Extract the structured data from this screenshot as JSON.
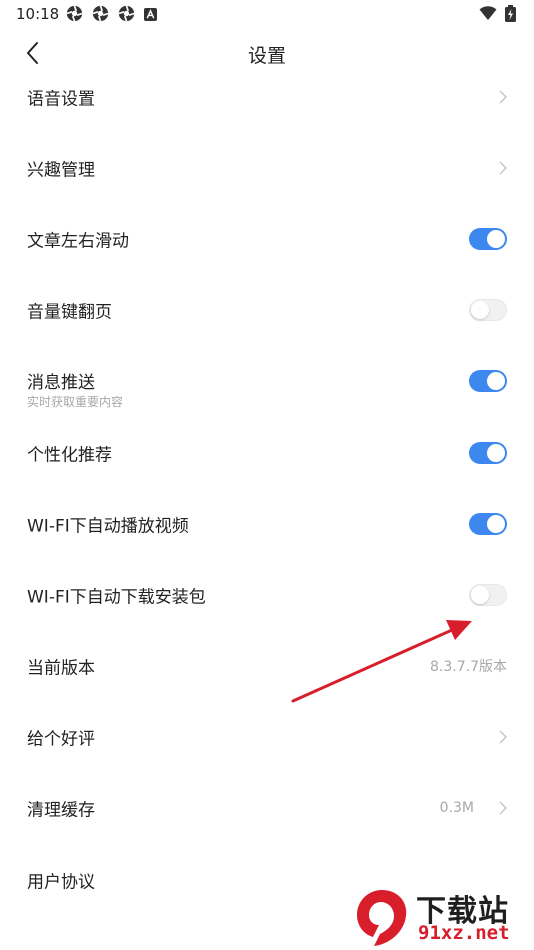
{
  "status_bar": {
    "time": "10:18",
    "left_icons": [
      "aperture-icon",
      "aperture-icon",
      "aperture-icon",
      "a-letter-icon"
    ],
    "right_icons": [
      "wifi-icon",
      "battery-charging-icon"
    ]
  },
  "header": {
    "title": "设置",
    "back_icon": "chevron-left-icon"
  },
  "settings": {
    "voice": {
      "label": "语音设置"
    },
    "interest": {
      "label": "兴趣管理"
    },
    "swipe": {
      "label": "文章左右滑动",
      "enabled": true
    },
    "volume_key": {
      "label": "音量键翻页",
      "enabled": false
    },
    "push": {
      "label": "消息推送",
      "sublabel": "实时获取重要内容",
      "enabled": true
    },
    "personalized": {
      "label": "个性化推荐",
      "enabled": true
    },
    "wifi_video": {
      "label": "WI-FI下自动播放视频",
      "enabled": true
    },
    "wifi_download": {
      "label": "WI-FI下自动下载安装包",
      "enabled": false
    },
    "version": {
      "label": "当前版本",
      "value": "8.3.7.7版本"
    },
    "rate": {
      "label": "给个好评"
    },
    "cache": {
      "label": "清理缓存",
      "value": "0.3M"
    },
    "agreement": {
      "label": "用户协议"
    }
  },
  "colors": {
    "toggle_on": "#3d88ef",
    "toggle_off": "#f1f1f1",
    "arrow": "#d81e2a"
  },
  "watermark": {
    "text": "下载站",
    "url": "91xz.net"
  }
}
